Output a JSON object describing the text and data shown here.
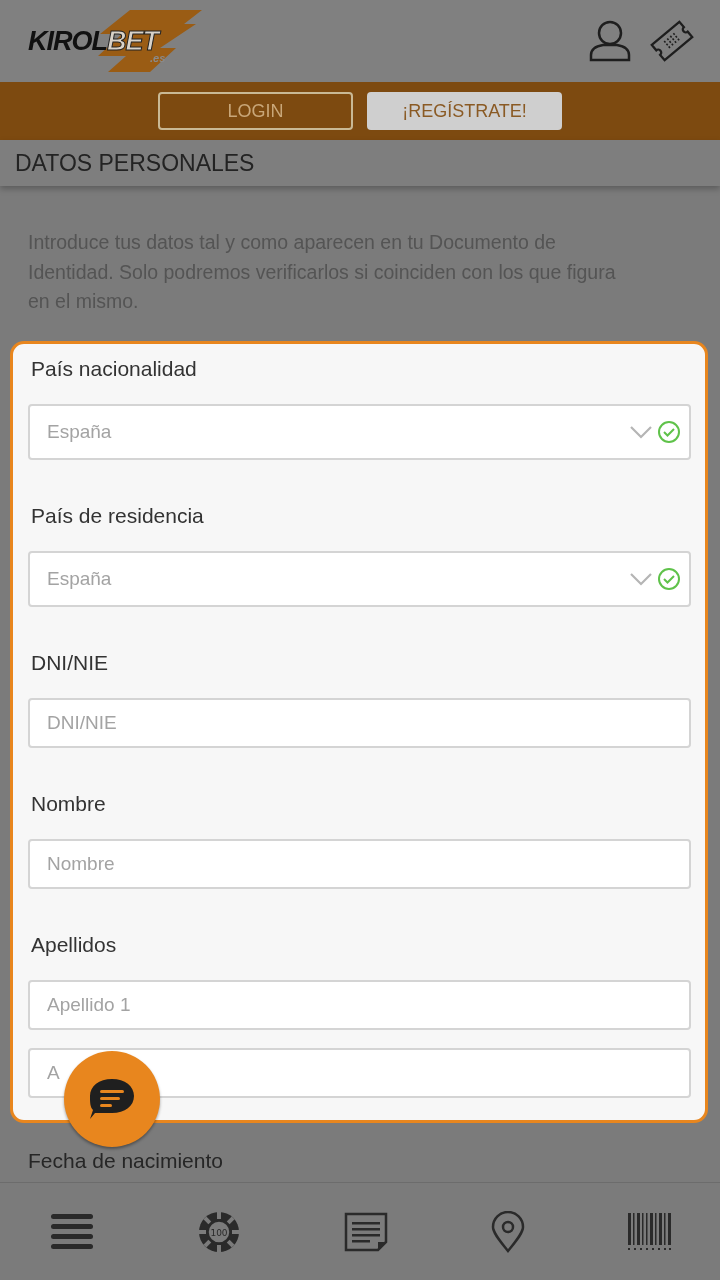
{
  "header": {
    "logo": {
      "text": "KIROL",
      "accent": "BET",
      "domain": ".es"
    }
  },
  "auth_bar": {
    "buttons": [
      {
        "label": "LOGIN",
        "kind": "outline"
      },
      {
        "label": "¡REGÍSTRATE!",
        "kind": "filled"
      }
    ]
  },
  "section_title": "DATOS PERSONALES",
  "intro": "Introduce tus datos tal y como aparecen en tu Documento de Identidad. Solo podremos verificarlos si coinciden con los que figura en el mismo.",
  "form": {
    "fields": [
      {
        "label": "País nacionalidad",
        "inputs": [
          {
            "kind": "select",
            "value": "España",
            "valid": true
          }
        ]
      },
      {
        "label": "País de residencia",
        "inputs": [
          {
            "kind": "select",
            "value": "España",
            "valid": true
          }
        ]
      },
      {
        "label": "DNI/NIE",
        "inputs": [
          {
            "kind": "text",
            "placeholder": "DNI/NIE"
          }
        ]
      },
      {
        "label": "Nombre",
        "inputs": [
          {
            "kind": "text",
            "placeholder": "Nombre"
          }
        ]
      },
      {
        "label": "Apellidos",
        "inputs": [
          {
            "kind": "text",
            "placeholder": "Apellido 1"
          },
          {
            "kind": "text",
            "placeholder": "A"
          }
        ]
      }
    ]
  },
  "next_label": "Fecha de nacimiento",
  "bottom_nav": [
    {
      "kind": "menu"
    },
    {
      "kind": "chip",
      "text": "100"
    },
    {
      "kind": "document"
    },
    {
      "kind": "location"
    },
    {
      "kind": "barcode"
    }
  ]
}
